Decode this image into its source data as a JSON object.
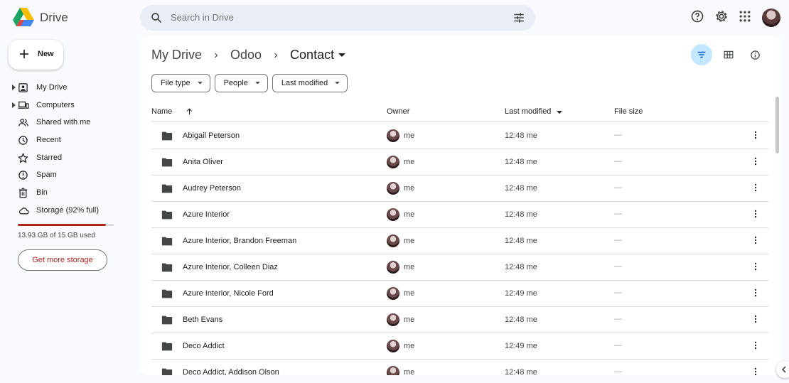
{
  "app": {
    "name": "Drive"
  },
  "search": {
    "placeholder": "Search in Drive"
  },
  "sidebar": {
    "new_label": "New",
    "items": [
      {
        "label": "My Drive",
        "icon": "my-drive-icon",
        "expandable": true
      },
      {
        "label": "Computers",
        "icon": "computer-icon",
        "expandable": true
      },
      {
        "label": "Shared with me",
        "icon": "people-icon",
        "expandable": false
      },
      {
        "label": "Recent",
        "icon": "clock-icon",
        "expandable": false
      },
      {
        "label": "Starred",
        "icon": "star-icon",
        "expandable": false
      },
      {
        "label": "Spam",
        "icon": "spam-icon",
        "expandable": false
      },
      {
        "label": "Bin",
        "icon": "trash-icon",
        "expandable": false
      },
      {
        "label": "Storage (92% full)",
        "icon": "cloud-icon",
        "expandable": false
      }
    ],
    "storage_used_fraction": 0.92,
    "storage_text": "13.93 GB of 15 GB used",
    "get_storage_label": "Get more storage"
  },
  "breadcrumb": {
    "root": "My Drive",
    "middle": "Odoo",
    "current": "Contact",
    "separator": "›"
  },
  "filters": {
    "file_type": "File type",
    "people": "People",
    "last_modified": "Last modified"
  },
  "table": {
    "columns": {
      "name": "Name",
      "owner": "Owner",
      "last_modified": "Last modified",
      "file_size": "File size"
    },
    "rows": [
      {
        "name": "Abigail Peterson",
        "owner": "me",
        "modified": "12:48 me",
        "size": "—"
      },
      {
        "name": "Anita Oliver",
        "owner": "me",
        "modified": "12:48 me",
        "size": "—"
      },
      {
        "name": "Audrey Peterson",
        "owner": "me",
        "modified": "12:48 me",
        "size": "—"
      },
      {
        "name": "Azure Interior",
        "owner": "me",
        "modified": "12:48 me",
        "size": "—"
      },
      {
        "name": "Azure Interior, Brandon Freeman",
        "owner": "me",
        "modified": "12:48 me",
        "size": "—"
      },
      {
        "name": "Azure Interior, Colleen Diaz",
        "owner": "me",
        "modified": "12:48 me",
        "size": "—"
      },
      {
        "name": "Azure Interior, Nicole Ford",
        "owner": "me",
        "modified": "12:49 me",
        "size": "—"
      },
      {
        "name": "Beth Evans",
        "owner": "me",
        "modified": "12:48 me",
        "size": "—"
      },
      {
        "name": "Deco Addict",
        "owner": "me",
        "modified": "12:49 me",
        "size": "—"
      },
      {
        "name": "Deco Addict, Addison Olson",
        "owner": "me",
        "modified": "12:48 me",
        "size": "—"
      }
    ]
  },
  "colors": {
    "accent": "#c2e7ff",
    "storage_warning": "#b3261e",
    "background": "#f8fafd"
  }
}
